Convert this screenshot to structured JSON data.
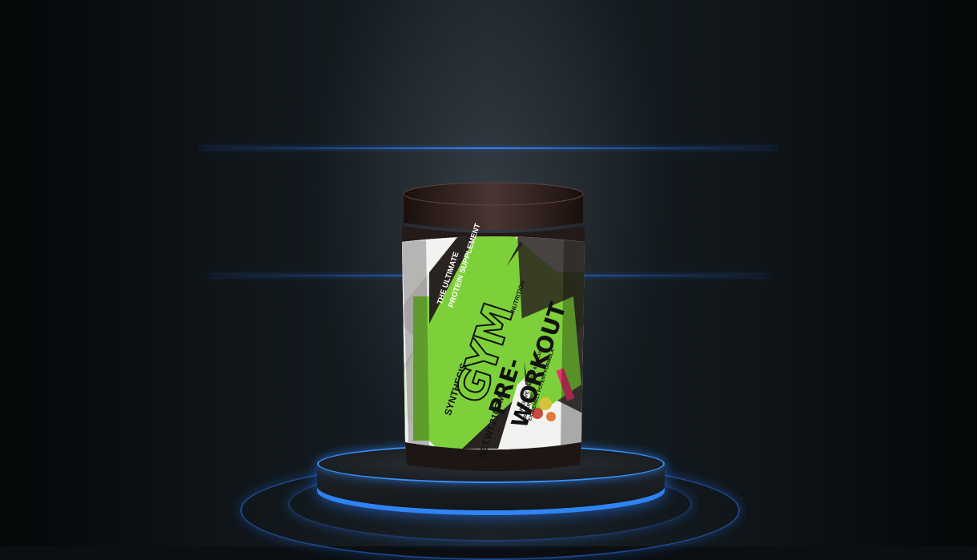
{
  "scene": {
    "description_free": true,
    "accent_color": "#7ed03a",
    "glow_color": "#3a8cff"
  },
  "product_label": {
    "brand_sideways": "SYNTHESIS",
    "tagline_line1": "THE ULTIMATE",
    "tagline_line2": "PROTEIN SUPPLEMENT",
    "logo": "GYM",
    "logo_sub": "NUTRITION",
    "name_line1": "PRE-",
    "name_line2": "WORKOUT",
    "net_weight": "NET.WT.210GM",
    "claims": "EXPLOSIVE ENERGY & FOCUS\n30 SERVINGS\nEXTREMELY POTENT FORMULA"
  }
}
